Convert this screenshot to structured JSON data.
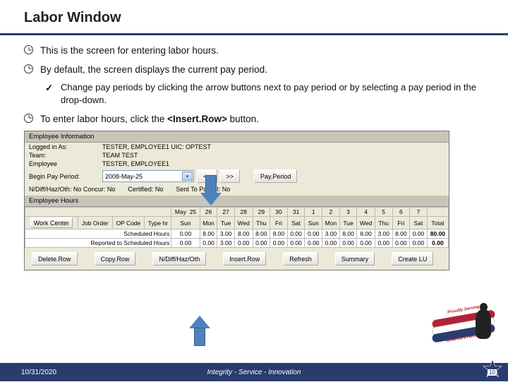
{
  "title": "Labor Window",
  "bullets": {
    "b1": "This is the screen for entering labor hours.",
    "b2": "By default, the screen displays the current pay period.",
    "b2s1": "Change pay periods by clicking the arrow buttons next to pay period or by selecting a pay period in the drop-down.",
    "b3_pre": "To enter labor hours, click the ",
    "b3_btn": "<Insert.Row>",
    "b3_post": " button."
  },
  "emp": {
    "section": "Employee Information",
    "logged_lbl": "Logged in As:",
    "logged_val": "TESTER, EMPLOYEE1 UIC: OPTEST",
    "team_lbl": "Team:",
    "team_val": "TEAM TEST",
    "emp_lbl": "Employee",
    "emp_val": "TESTER, EMPLOYEE1",
    "begin_lbl": "Begin Pay Period:",
    "begin_val": "2008-May-25",
    "prev": "<<",
    "next": ">>",
    "payperiod_btn": "Pay.Period",
    "flags": "N/Diff/Haz/Oth: No Concur: No",
    "cert": "Certified: No",
    "sent": "Sent To Payroll: No"
  },
  "hrs_section": "Employee Hours",
  "cols": {
    "wc": "Work Center",
    "jo": "Job Order",
    "op": "OP Code",
    "th": "Type hr",
    "mon_lbl": "May",
    "total": "Total"
  },
  "days": {
    "dates": [
      "25",
      "26",
      "27",
      "28",
      "29",
      "30",
      "31",
      "1",
      "2",
      "3",
      "4",
      "5",
      "6",
      "7"
    ],
    "names": [
      "Sun",
      "Mon",
      "Tue",
      "Wed",
      "Thu",
      "Fri",
      "Sat",
      "Sun",
      "Mon",
      "Tue",
      "Wed",
      "Thu",
      "Fri",
      "Sat"
    ]
  },
  "rows": {
    "sched_lbl": "Scheduled Hours",
    "sched": [
      "0.00",
      "8.00",
      "3.00",
      "8.00",
      "8.00",
      "8.00",
      "0.00",
      "0.00",
      "3.00",
      "8.00",
      "8.00",
      "3.00",
      "8.00",
      "0.00"
    ],
    "sched_total": "80.00",
    "rep_lbl": "Reported to Scheduled Hours",
    "rep": [
      "0.00",
      "0.00",
      "3.00",
      "0.00",
      "0.00",
      "0.00",
      "0.00",
      "0.00",
      "0.00",
      "0.00",
      "0.00",
      "0.00",
      "0.00",
      "0.00"
    ],
    "rep_total": "0.00"
  },
  "buttons": {
    "del": "Delete.Row",
    "copy": "Copy.Row",
    "ndiff": "N/Diff/Haz/Oth",
    "ins": "Insert.Row",
    "ref": "Refresh",
    "sum": "Summary",
    "lu": "Create LU"
  },
  "footer": {
    "date": "10/31/2020",
    "motto": "Integrity - Service - Innovation",
    "page": "10",
    "ribbon_top": "Proudly Serving",
    "ribbon_bot": "America's Heroes"
  }
}
